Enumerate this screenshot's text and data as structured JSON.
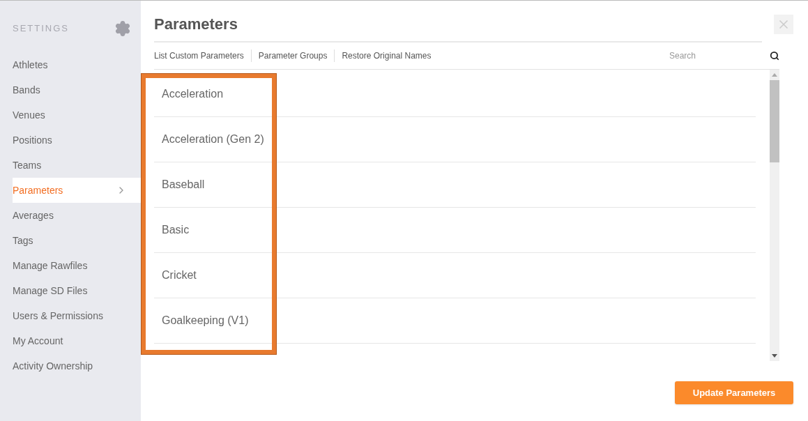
{
  "sidebar": {
    "heading": "SETTINGS",
    "items": [
      {
        "label": "Athletes",
        "selected": false
      },
      {
        "label": "Bands",
        "selected": false
      },
      {
        "label": "Venues",
        "selected": false
      },
      {
        "label": "Positions",
        "selected": false
      },
      {
        "label": "Teams",
        "selected": false
      },
      {
        "label": "Parameters",
        "selected": true
      },
      {
        "label": "Averages",
        "selected": false
      },
      {
        "label": "Tags",
        "selected": false
      },
      {
        "label": "Manage Rawfiles",
        "selected": false
      },
      {
        "label": "Manage SD Files",
        "selected": false
      },
      {
        "label": "Users & Permissions",
        "selected": false
      },
      {
        "label": "My Account",
        "selected": false
      },
      {
        "label": "Activity Ownership",
        "selected": false
      }
    ]
  },
  "title": "Parameters",
  "toolbar": {
    "links": [
      "List Custom Parameters",
      "Parameter Groups",
      "Restore Original Names"
    ],
    "search": {
      "placeholder": "Search"
    }
  },
  "list": [
    "Acceleration",
    "Acceleration (Gen 2)",
    "Baseball",
    "Basic",
    "Cricket",
    "Goalkeeping (V1)"
  ],
  "button": "Update Parameters"
}
